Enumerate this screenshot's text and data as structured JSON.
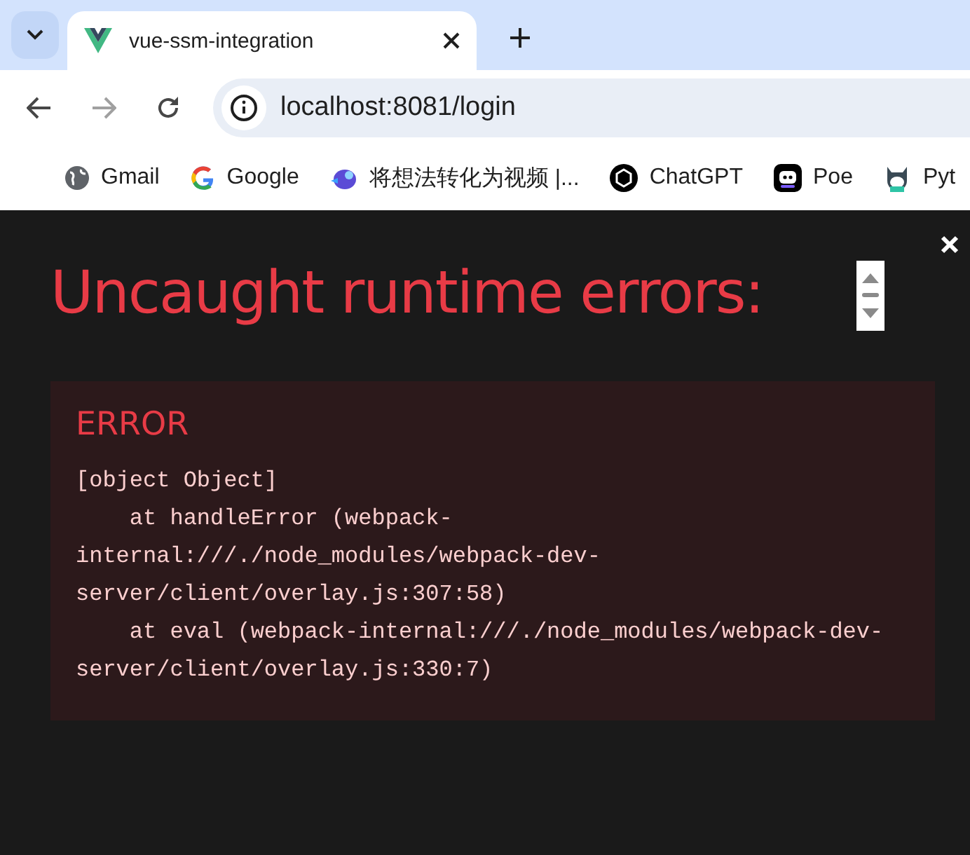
{
  "browser": {
    "tab": {
      "title": "vue-ssm-integration"
    },
    "address": "localhost:8081/login",
    "bookmarks": [
      {
        "label": "Gmail",
        "kind": "globe"
      },
      {
        "label": "Google",
        "kind": "google"
      },
      {
        "label": "将想法转化为视频 |...",
        "kind": "bird"
      },
      {
        "label": "ChatGPT",
        "kind": "chatgpt"
      },
      {
        "label": "Poe",
        "kind": "poe"
      },
      {
        "label": "Pyt",
        "kind": "mascot"
      }
    ]
  },
  "overlay": {
    "title": "Uncaught runtime errors:",
    "errors": [
      {
        "heading": "ERROR",
        "lines": [
          "[object Object]",
          "    at handleError (webpack-internal:///./node_modules/webpack-dev-server/client/overlay.js:307:58)",
          "    at eval (webpack-internal:///./node_modules/webpack-dev-server/client/overlay.js:330:7)"
        ]
      }
    ]
  }
}
